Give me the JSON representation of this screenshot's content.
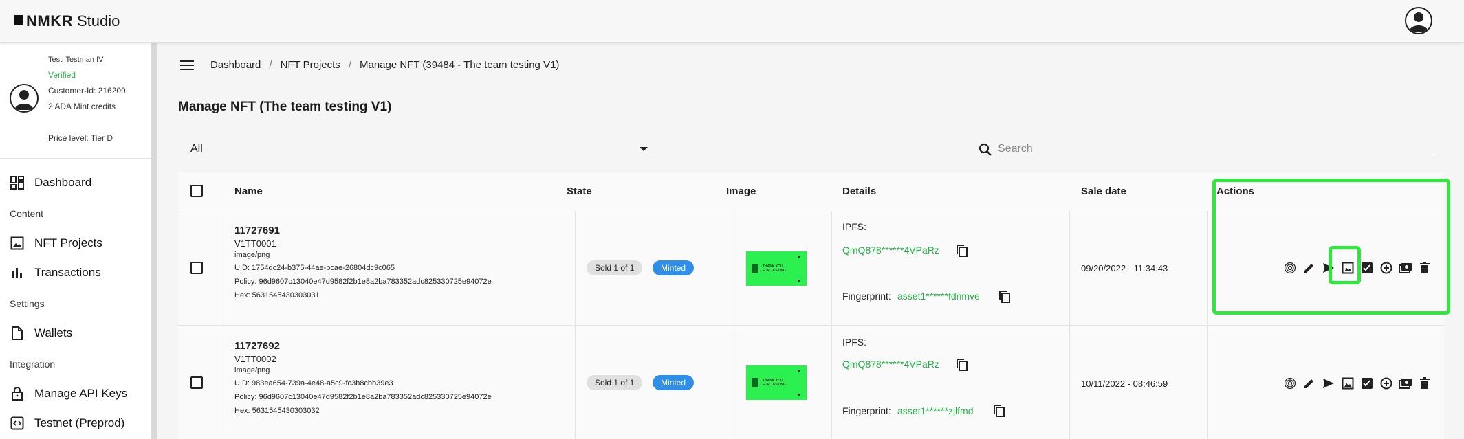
{
  "app": {
    "brand_strong": "NMKR",
    "brand_light": "Studio"
  },
  "profile": {
    "name": "Testi Testman IV",
    "status": "Verified",
    "customer_id": "Customer-Id: 216209",
    "credits": "2 ADA Mint credits",
    "price_level": "Price level: Tier D"
  },
  "sidebar": {
    "dashboard": "Dashboard",
    "section_content": "Content",
    "nft_projects": "NFT Projects",
    "transactions": "Transactions",
    "section_settings": "Settings",
    "wallets": "Wallets",
    "section_integration": "Integration",
    "api_keys": "Manage API Keys",
    "testnet": "Testnet (Preprod)"
  },
  "breadcrumb": {
    "items": [
      "Dashboard",
      "NFT Projects",
      "Manage NFT (39484 - The team testing V1)"
    ],
    "separator": "/"
  },
  "page": {
    "title": "Manage NFT (The team testing V1)"
  },
  "filter": {
    "selected": "All"
  },
  "search": {
    "placeholder": "Search",
    "value": ""
  },
  "table": {
    "headers": {
      "name": "Name",
      "state": "State",
      "image": "Image",
      "details": "Details",
      "sale_date": "Sale date",
      "actions": "Actions"
    },
    "rows": [
      {
        "id": "11727691",
        "name": "V1TT0001",
        "mime": "image/png",
        "uid": "UID: 1754dc24-b375-44ae-bcae-26804dc9c065",
        "policy": "Policy: 96d9607c13040e47d9582f2b1e8a2ba783352adc825330725e94072e",
        "hex": "Hex: 5631545430303031",
        "sold": "Sold 1 of 1",
        "state": "Minted",
        "thumb_text": "THANK YOU FOR TESTING",
        "ipfs_label": "IPFS:",
        "ipfs": "QmQ878******4VPaRz",
        "fingerprint_label": "Fingerprint:",
        "fingerprint": "asset1******fdnmve",
        "sale_date": "09/20/2022 - 11:34:43"
      },
      {
        "id": "11727692",
        "name": "V1TT0002",
        "mime": "image/png",
        "uid": "UID: 983ea654-739a-4e48-a5c9-fc3b8cbb39e3",
        "policy": "Policy: 96d9607c13040e47d9582f2b1e8a2ba783352adc825330725e94072e",
        "hex": "Hex: 5631545430303032",
        "sold": "Sold 1 of 1",
        "state": "Minted",
        "thumb_text": "THANK YOU FOR TESTING",
        "ipfs_label": "IPFS:",
        "ipfs": "QmQ878******4VPaRz",
        "fingerprint_label": "Fingerprint:",
        "fingerprint": "asset1******zjlfmd",
        "sale_date": "10/11/2022 - 08:46:59"
      }
    ]
  },
  "colors": {
    "accent_green": "#23b146",
    "minted_blue": "#2f8ee8",
    "highlight": "#2fe83c"
  },
  "icons": [
    "fingerprint-icon",
    "edit-icon",
    "send-icon",
    "image-icon",
    "check-list-icon",
    "add-circle-icon",
    "payment-icon",
    "delete-icon"
  ]
}
